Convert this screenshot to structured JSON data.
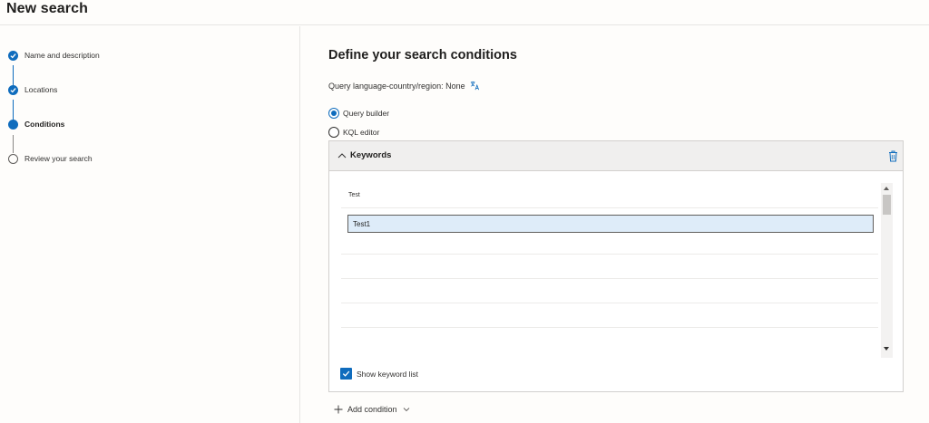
{
  "header": {
    "title": "New search"
  },
  "steps": [
    {
      "label": "Name and description",
      "state": "done"
    },
    {
      "label": "Locations",
      "state": "done"
    },
    {
      "label": "Conditions",
      "state": "current"
    },
    {
      "label": "Review your search",
      "state": "pending"
    }
  ],
  "main": {
    "title": "Define your search conditions",
    "query_language": "Query language-country/region: None",
    "options": [
      {
        "label": "Query builder",
        "selected": true
      },
      {
        "label": "KQL editor",
        "selected": false
      }
    ]
  },
  "keywords_card": {
    "title": "Keywords",
    "field_label": "Test",
    "input_value": "Test1",
    "show_keyword_list_label": "Show keyword list",
    "show_keyword_list_checked": true
  },
  "add_condition_label": "Add condition",
  "colors": {
    "accent": "#0f6cbd",
    "input_bg": "#deecf9"
  }
}
